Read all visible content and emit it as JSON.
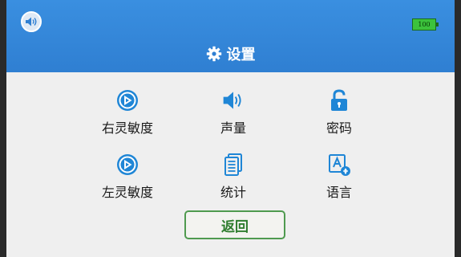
{
  "status_bar": {
    "sound_icon": "speaker-icon",
    "battery_level": "100"
  },
  "header": {
    "title": "设置",
    "title_icon": "gear-icon",
    "accent_color": "#2f85d8"
  },
  "menu": {
    "items": [
      {
        "label": "右灵敏度",
        "icon": "sensitivity-icon"
      },
      {
        "label": "声量",
        "icon": "volume-icon"
      },
      {
        "label": "密码",
        "icon": "lock-icon"
      },
      {
        "label": "左灵敏度",
        "icon": "sensitivity-icon"
      },
      {
        "label": "统计",
        "icon": "documents-icon"
      },
      {
        "label": "语言",
        "icon": "language-icon"
      }
    ]
  },
  "footer": {
    "back_label": "返回",
    "back_color": "#2e7d2e"
  }
}
